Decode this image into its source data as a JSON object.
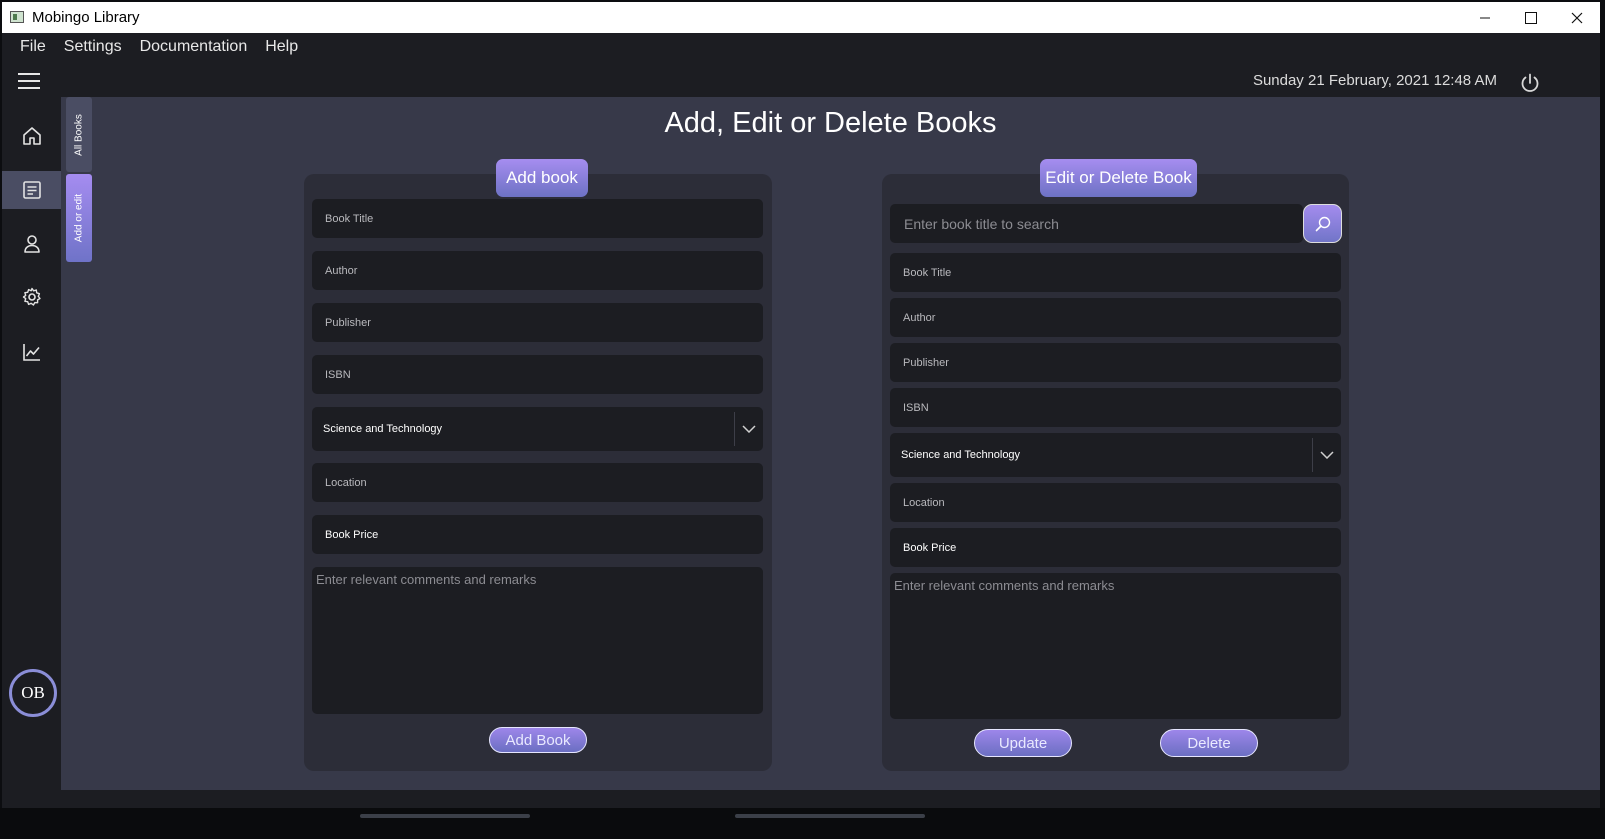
{
  "window": {
    "title": "Mobingo Library"
  },
  "menu": {
    "items": [
      "File",
      "Settings",
      "Documentation",
      "Help"
    ]
  },
  "header": {
    "datetime": "Sunday 21 February, 2021 12:48 AM"
  },
  "sidebar": {
    "items": [
      {
        "name": "home",
        "icon": "home-icon"
      },
      {
        "name": "books",
        "icon": "book-list-icon",
        "active": true
      },
      {
        "name": "users",
        "icon": "user-icon"
      },
      {
        "name": "settings",
        "icon": "gear-icon"
      },
      {
        "name": "reports",
        "icon": "chart-icon"
      }
    ],
    "avatar": "OB"
  },
  "vertical_tabs": {
    "all_books": "All Books",
    "add_or_edit": "Add or edit"
  },
  "page": {
    "title": "Add, Edit or Delete Books"
  },
  "add_panel": {
    "badge": "Add book",
    "fields": {
      "title": "Book Title",
      "author": "Author",
      "publisher": "Publisher",
      "isbn": "ISBN",
      "category": "Science and Technology",
      "location": "Location",
      "price": "Book Price"
    },
    "comments_placeholder": "Enter relevant comments and remarks",
    "submit_label": "Add Book"
  },
  "edit_panel": {
    "badge": "Edit or Delete Book",
    "search_placeholder": "Enter book title to search",
    "fields": {
      "title": "Book Title",
      "author": "Author",
      "publisher": "Publisher",
      "isbn": "ISBN",
      "category": "Science and Technology",
      "location": "Location",
      "price": "Book Price"
    },
    "comments_placeholder": "Enter relevant comments and remarks",
    "update_label": "Update",
    "delete_label": "Delete"
  },
  "colors": {
    "accent_top": "#a68df0",
    "accent_bottom": "#6d72c4",
    "main_bg": "#373949",
    "panel_bg": "#2c2d38",
    "field_bg": "#1c1d22"
  }
}
